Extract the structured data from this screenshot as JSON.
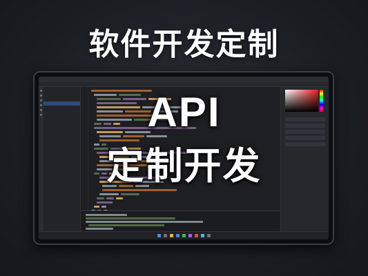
{
  "banner": {
    "title": "软件开发定制"
  },
  "overlay": {
    "line1": "API",
    "line2": "定制开发"
  },
  "screen": {
    "tree_items": [
      "",
      "",
      "",
      "",
      "",
      "",
      "",
      "",
      "",
      "",
      "",
      "",
      "",
      "",
      "",
      "",
      ""
    ],
    "selected_index": 3
  },
  "colors": {
    "accent_blue": "#2f4a7a",
    "code_keyword": "#cc7832",
    "code_string": "#6a8759",
    "code_type": "#9876aa",
    "code_plain": "#a9b7c6",
    "code_func": "#ffc66d",
    "picker_red": "#e81c1c"
  }
}
